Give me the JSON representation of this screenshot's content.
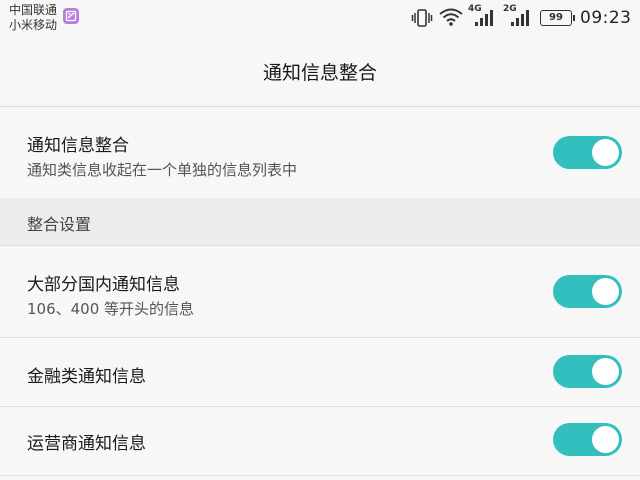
{
  "status_bar": {
    "carrier_1": "中国联通",
    "carrier_2": "小米移动",
    "network_1": "4G",
    "network_2": "2G",
    "battery": "99",
    "time": "09:23",
    "icons": [
      "app-notification-icon",
      "vibrate-icon",
      "wifi-icon",
      "signal-4g-icon",
      "signal-2g-icon",
      "battery-icon"
    ]
  },
  "header": {
    "title": "通知信息整合"
  },
  "main_setting": {
    "title": "通知信息整合",
    "subtitle": "通知类信息收起在一个单独的信息列表中",
    "enabled": true
  },
  "section": {
    "label": "整合设置"
  },
  "settings": [
    {
      "title": "大部分国内通知信息",
      "subtitle": "106、400 等开头的信息",
      "enabled": true
    },
    {
      "title": "金融类通知信息",
      "enabled": true
    },
    {
      "title": "运营商通知信息",
      "enabled": true
    }
  ],
  "colors": {
    "accent": "#34bfbf",
    "background": "#f7f7f7",
    "section_background": "#ececec"
  }
}
